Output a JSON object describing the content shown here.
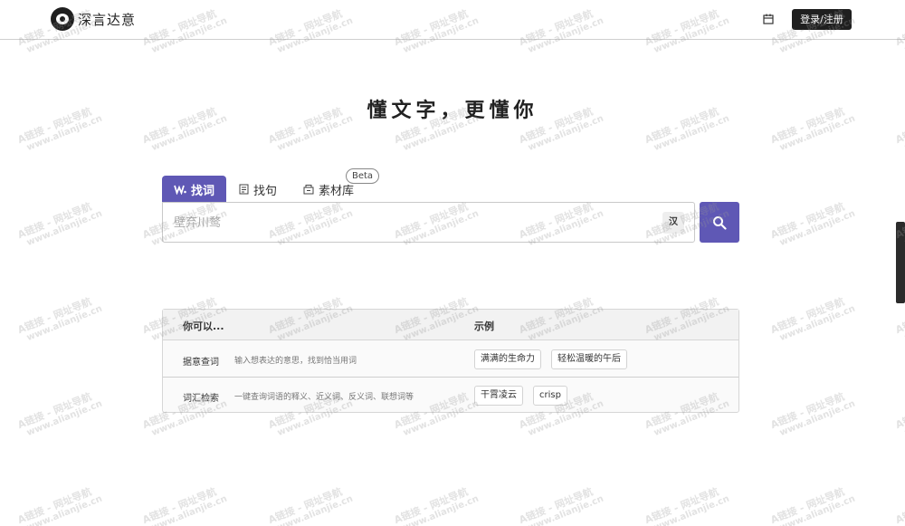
{
  "header": {
    "logo_text": "深言达意",
    "calendar_icon": "calendar-icon",
    "login_label": "登录/注册"
  },
  "headline": "懂文字，更懂你",
  "tabs": [
    {
      "label": "找词",
      "icon": "word-icon",
      "active": true
    },
    {
      "label": "找句",
      "icon": "sentence-icon",
      "active": false
    },
    {
      "label": "素材库",
      "icon": "material-icon",
      "active": false,
      "badge": "Beta"
    }
  ],
  "search": {
    "placeholder": "壁弃川鹜",
    "han_label": "汉",
    "button_icon": "search-icon"
  },
  "table": {
    "col_task": "你可以...",
    "col_example": "示例",
    "rows": [
      {
        "title": "据意查词",
        "desc": "输入想表达的意思，找到恰当用词",
        "examples": [
          "满满的生命力",
          "轻松温暖的午后"
        ]
      },
      {
        "title": "词汇检索",
        "desc": "一键查询词语的释义、近义词、反义词、联想词等",
        "examples": [
          "干霄凌云",
          "crisp"
        ]
      }
    ]
  },
  "watermark": {
    "line1": "A链接 - 网址导航",
    "line2": "www.alianjie.cn"
  },
  "colors": {
    "accent": "#5f58b5",
    "button_dark": "#1f1f1f"
  }
}
